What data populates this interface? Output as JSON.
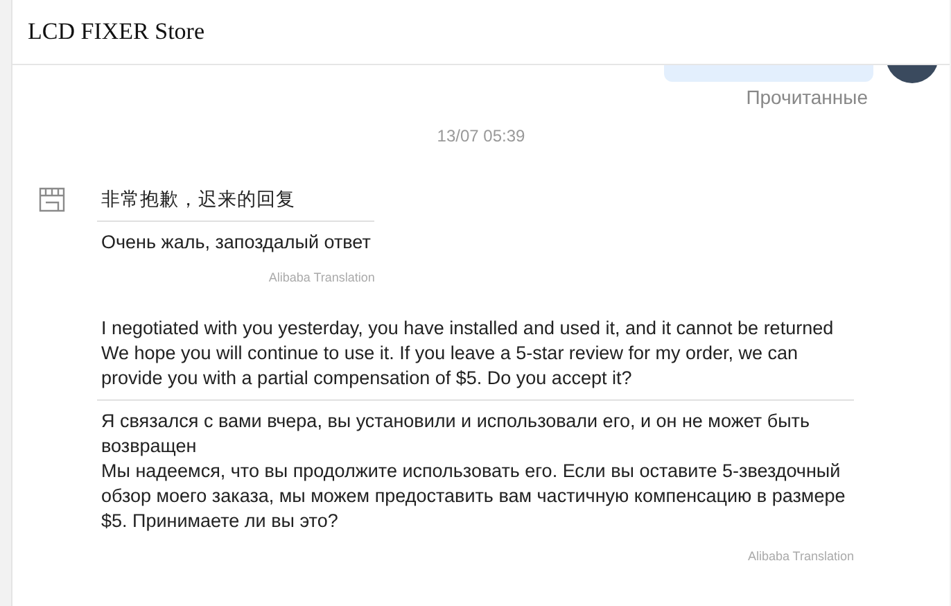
{
  "window": {
    "title": "LCD FIXER Store"
  },
  "messages": [
    {
      "kind": "sent",
      "status": "Прочитанные"
    },
    {
      "kind": "timestamp",
      "text": "13/07 05:39"
    },
    {
      "kind": "received",
      "show_store_icon": true,
      "original": "非常抱歉，迟来的回复",
      "translation": "Очень жаль, запоздалый ответ",
      "credit": "Alibaba Translation"
    },
    {
      "kind": "received",
      "show_store_icon": false,
      "original": "I negotiated with you yesterday, you have installed and used it, and it cannot be returned\nWe hope you will continue to use it. If you leave a 5-star review for my order, we can provide you with a partial compensation of $5. Do you accept it?",
      "translation": "Я связался с вами вчера, вы установили и использовали его, и он не может быть возвращен\nМы надеемся, что вы продолжите использовать его. Если вы оставите 5-звездочный обзор моего заказа, мы можем предоставить вам частичную компенсацию в размере $5. Принимаете ли вы это?",
      "credit": "Alibaba Translation"
    }
  ]
}
